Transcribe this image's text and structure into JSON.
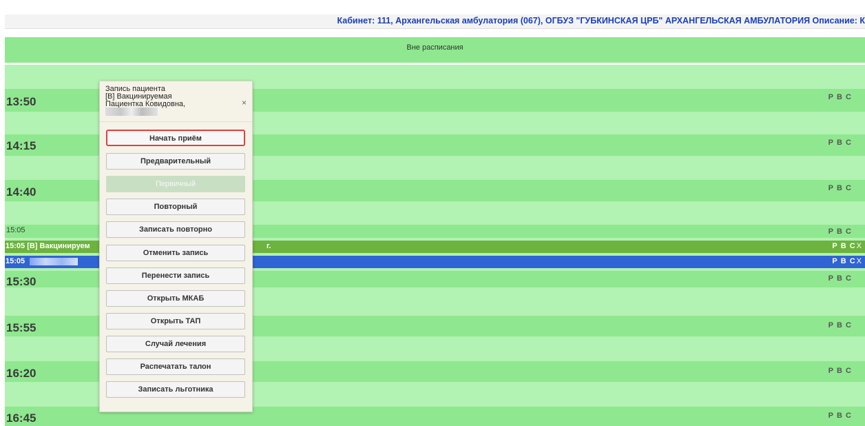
{
  "header": {
    "text": "Кабинет: 111, Архангельская амбулатория (067), ОГБУЗ \"ГУБКИНСКАЯ ЦРБ\" АРХАНГЕЛЬСКАЯ АМБУЛАТОРИЯ Описание: К"
  },
  "unscheduled": {
    "label": "Вне расписания"
  },
  "slots": [
    {
      "time": "13:50",
      "rvs": "Р В С"
    },
    {
      "time": "14:15",
      "rvs": "Р В С"
    },
    {
      "time": "14:40",
      "rvs": "Р В С"
    },
    {
      "time": "15:05",
      "rvs": "Р В С"
    },
    {
      "time": "15:30",
      "rvs": "Р В С"
    },
    {
      "time": "15:55",
      "rvs": "Р В С"
    },
    {
      "time": "16:20",
      "rvs": "Р В С"
    },
    {
      "time": "16:45",
      "rvs": "Р В С"
    }
  ],
  "appointments": [
    {
      "label": "15:05 [В] Вакцинируем",
      "tail": "г.",
      "rvs": "Р В С",
      "close": "X",
      "color": "#6db33f"
    },
    {
      "label": "15:05",
      "rvs": "Р В С",
      "close": "X",
      "color": "#2f64d4"
    }
  ],
  "popup": {
    "title_line1": "Запись пациента",
    "title_line2": "[В] Вакцинируемая",
    "title_line3": "Пациентка Ковидовна,",
    "close": "×",
    "buttons": {
      "start": "Начать приём",
      "preliminary": "Предварительный",
      "primary": "Первичный",
      "repeat": "Повторный",
      "record_again": "Записать повторно",
      "cancel": "Отменить запись",
      "move": "Перенести запись",
      "open_mkab": "Открыть МКАБ",
      "open_tap": "Открыть ТАП",
      "treatment_case": "Случай лечения",
      "print_ticket": "Распечатать талон",
      "record_beneficiary": "Записать льготника"
    }
  }
}
